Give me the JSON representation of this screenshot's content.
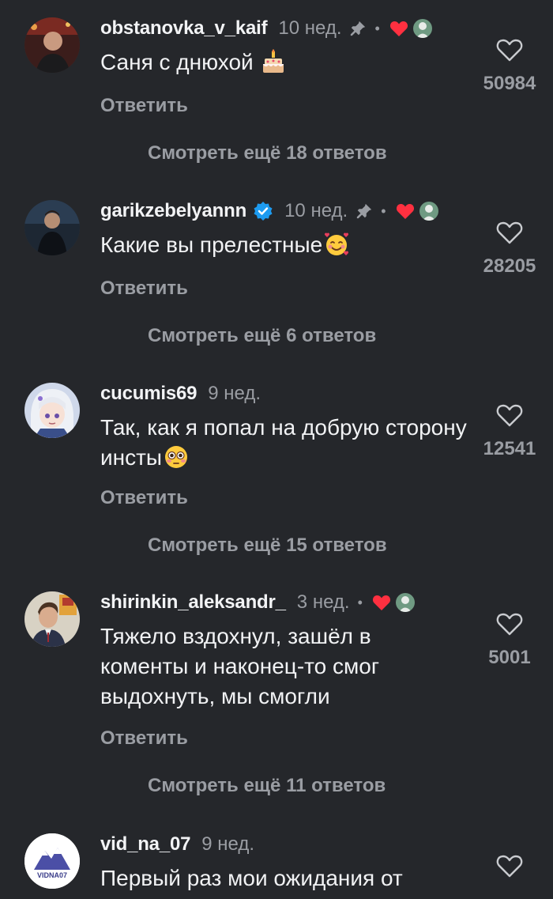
{
  "comments": [
    {
      "username": "obstanovka_v_kaif",
      "time": "10 нед.",
      "text": "Саня с днюхой",
      "emoji": "birthday-cake",
      "reply_label": "Ответить",
      "likes": "50984",
      "more_replies": "Смотреть ещё 18 ответов",
      "pinned": true,
      "verified": false,
      "author_liked": true
    },
    {
      "username": "garikzebelyannn",
      "time": "10 нед.",
      "text": "Какие вы прелестные",
      "emoji": "smiling-face-with-hearts",
      "reply_label": "Ответить",
      "likes": "28205",
      "more_replies": "Смотреть ещё 6 ответов",
      "pinned": true,
      "verified": true,
      "author_liked": true
    },
    {
      "username": "cucumis69",
      "time": "9 нед.",
      "text": "Так, как я попал на добрую сторону инсты",
      "emoji": "flushed-face",
      "reply_label": "Ответить",
      "likes": "12541",
      "more_replies": "Смотреть ещё 15 ответов",
      "pinned": false,
      "verified": false,
      "author_liked": false
    },
    {
      "username": "shirinkin_aleksandr_",
      "time": "3 нед.",
      "text": "Тяжело вздохнул, зашёл в коменты и наконец-то смог выдохнуть, мы смогли",
      "emoji": "",
      "reply_label": "Ответить",
      "likes": "5001",
      "more_replies": "Смотреть ещё 11 ответов",
      "pinned": false,
      "verified": false,
      "author_liked": true
    },
    {
      "username": "vid_na_07",
      "time": "9 нед.",
      "text": "Первый раз мои ожидания от",
      "emoji": "",
      "avatar_text": "VIDNA07",
      "pinned": false,
      "verified": false,
      "author_liked": false
    }
  ],
  "colors": {
    "background": "#25272b",
    "text_primary": "#f1f2f4",
    "text_secondary": "#9a9da3",
    "like_red": "#ff3040",
    "verified_blue": "#1d9bf0"
  }
}
